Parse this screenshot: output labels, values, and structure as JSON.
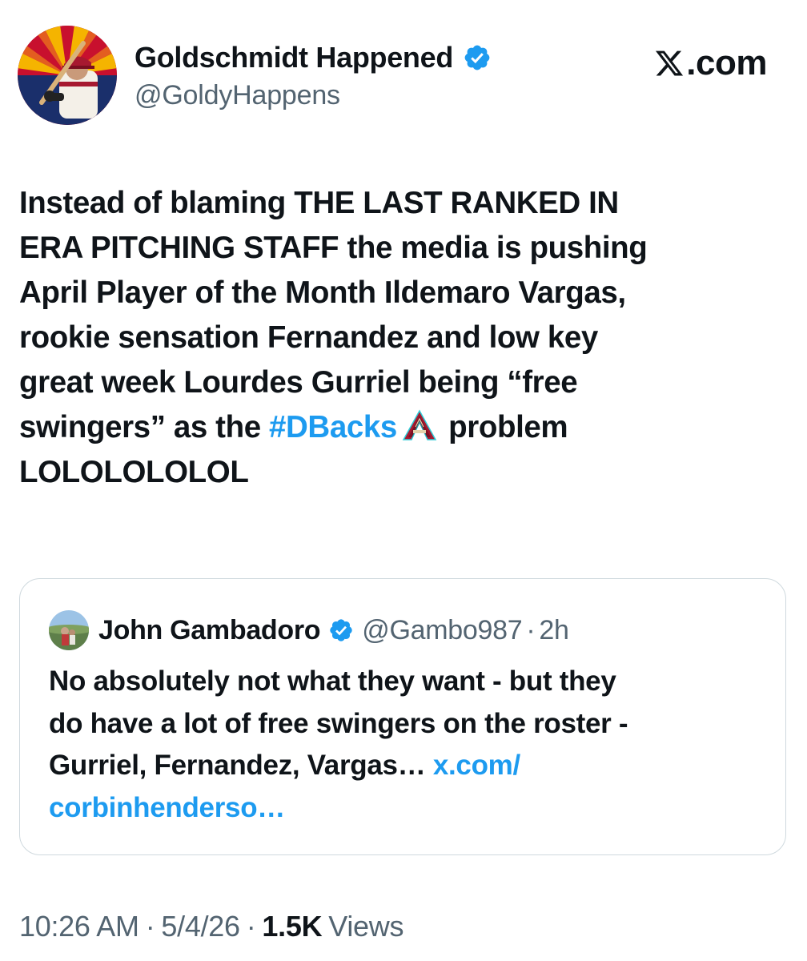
{
  "header": {
    "display_name": "Goldschmidt Happened",
    "handle": "@GoldyHappens",
    "site_label": ".com"
  },
  "tweet": {
    "lines": [
      "Instead of blaming THE LAST RANKED IN",
      "ERA PITCHING STAFF the media is pushing",
      "April Player of the Month Ildemaro Vargas,",
      "rookie sensation Fernandez and low key",
      "great week Lourdes Gurriel being “free",
      "swingers” as the ",
      "LOLOLOLOLOL"
    ],
    "hashtag": "#DBacks",
    "after_hashtag": " problem"
  },
  "quote": {
    "display_name": "John Gambadoro",
    "handle": "@Gambo987",
    "separator": "·",
    "time": "2h",
    "lines": [
      "No absolutely not what they want - but they",
      "do have a lot of free swingers on the roster -",
      "Gurriel, Fernandez, Vargas… "
    ],
    "link_part1": "x.com/",
    "link_part2": "corbinhenderso…"
  },
  "footer": {
    "time": "10:26 AM",
    "date": "5/4/26",
    "separator": "·",
    "views_count": "1.5K",
    "views_label": "Views"
  },
  "colors": {
    "accent": "#1d9bf0",
    "text": "#0f1419",
    "muted": "#536471",
    "border": "#cfd9de",
    "dbacks_red": "#a71930"
  },
  "icons": {
    "verified": "verified-badge-icon",
    "x_logo": "x-logo-icon",
    "team": "dbacks-a-logo-icon"
  }
}
